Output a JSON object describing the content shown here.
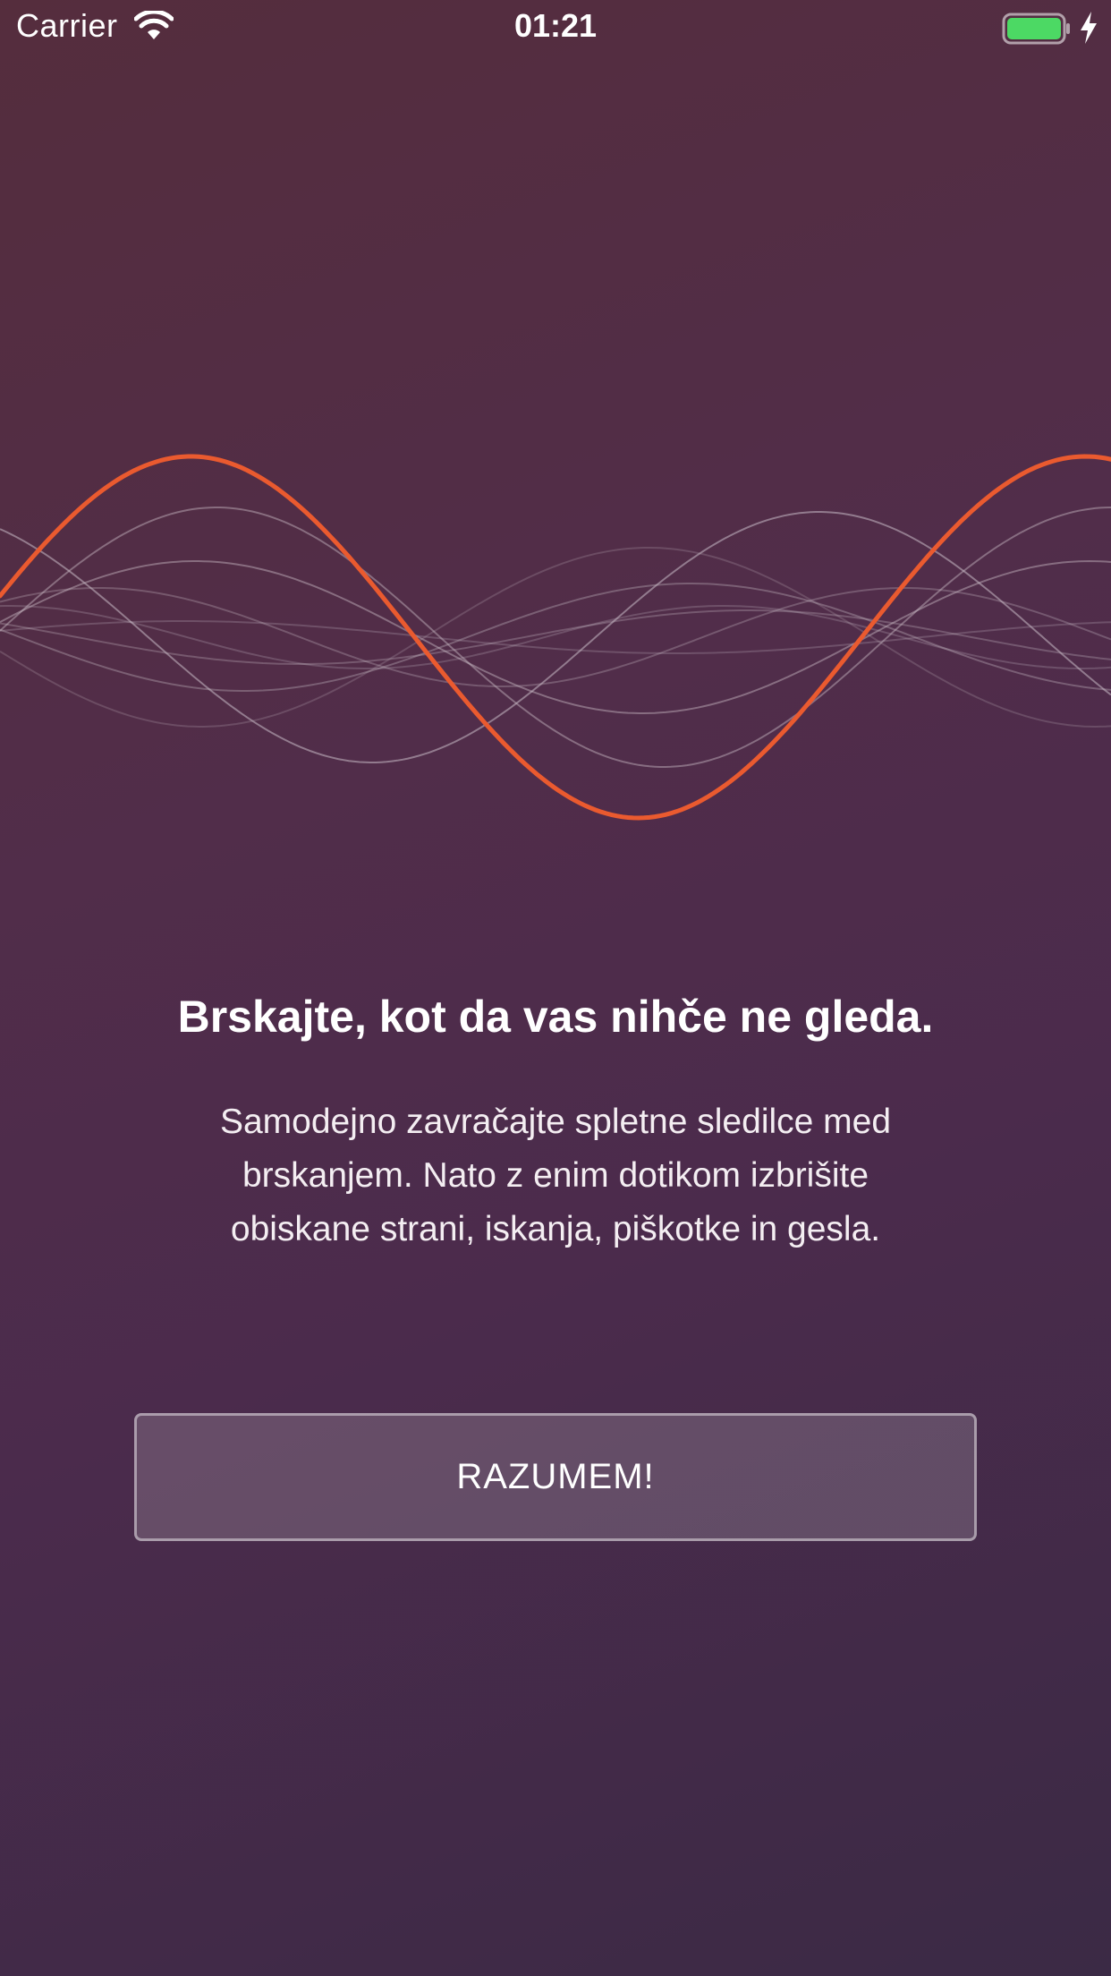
{
  "status_bar": {
    "carrier": "Carrier",
    "time": "01:21",
    "battery_color": "#4cd964",
    "icons": [
      "wifi-icon",
      "battery-icon",
      "charging-bolt-icon"
    ]
  },
  "illustration": {
    "icon": "sound-wave-illustration",
    "accent_color": "#ea5a2f",
    "line_color": "#c9bcc6"
  },
  "onboarding": {
    "title": "Brskajte, kot da vas nihče ne gleda.",
    "description_lines": [
      "Samodejno zavračajte spletne sledilce med",
      "brskanjem. Nato z enim dotikom izbrišite",
      "obiskane strani, iskanja, piškotke in gesla."
    ],
    "button_label": "RAZUMEM!"
  },
  "colors": {
    "background_top": "#552d3d",
    "background_bottom": "#3b2a45",
    "accent": "#ea5a2f"
  }
}
